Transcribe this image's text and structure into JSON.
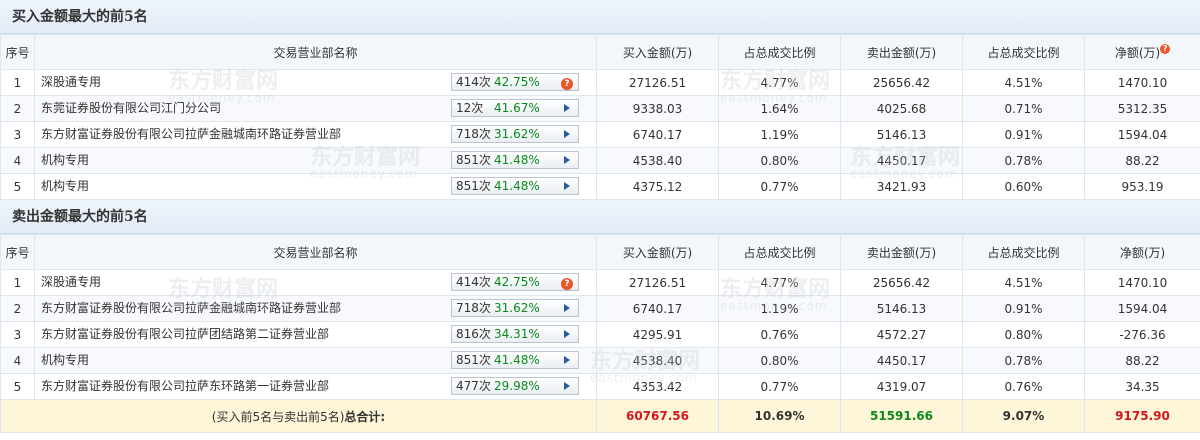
{
  "buy_section": {
    "title": "买入金额最大的前5名",
    "headers": [
      "序号",
      "交易营业部名称",
      "买入金额(万)",
      "占总成交比例",
      "卖出金额(万)",
      "占总成交比例",
      "净额(万)"
    ],
    "rows": [
      {
        "idx": "1",
        "name": "深股通专用",
        "count": "414次",
        "pct": "42.75%",
        "buy": "27126.51",
        "buy_ratio": "4.77%",
        "sell": "25656.42",
        "sell_ratio": "4.51%",
        "net": "1470.10",
        "icon": "question-icon"
      },
      {
        "idx": "2",
        "name": "东莞证券股份有限公司江门分公司",
        "count": "12次",
        "pct": "41.67%",
        "buy": "9338.03",
        "buy_ratio": "1.64%",
        "sell": "4025.68",
        "sell_ratio": "0.71%",
        "net": "5312.35",
        "icon": "play-icon"
      },
      {
        "idx": "3",
        "name": "东方财富证券股份有限公司拉萨金融城南环路证券营业部",
        "count": "718次",
        "pct": "31.62%",
        "buy": "6740.17",
        "buy_ratio": "1.19%",
        "sell": "5146.13",
        "sell_ratio": "0.91%",
        "net": "1594.04",
        "icon": "play-icon"
      },
      {
        "idx": "4",
        "name": "机构专用",
        "count": "851次",
        "pct": "41.48%",
        "buy": "4538.40",
        "buy_ratio": "0.80%",
        "sell": "4450.17",
        "sell_ratio": "0.78%",
        "net": "88.22",
        "icon": "play-icon"
      },
      {
        "idx": "5",
        "name": "机构专用",
        "count": "851次",
        "pct": "41.48%",
        "buy": "4375.12",
        "buy_ratio": "0.77%",
        "sell": "3421.93",
        "sell_ratio": "0.60%",
        "net": "953.19",
        "icon": "play-icon"
      }
    ]
  },
  "sell_section": {
    "title": "卖出金额最大的前5名",
    "headers": [
      "序号",
      "交易营业部名称",
      "买入金额(万)",
      "占总成交比例",
      "卖出金额(万)",
      "占总成交比例",
      "净额(万)"
    ],
    "rows": [
      {
        "idx": "1",
        "name": "深股通专用",
        "count": "414次",
        "pct": "42.75%",
        "buy": "27126.51",
        "buy_ratio": "4.77%",
        "sell": "25656.42",
        "sell_ratio": "4.51%",
        "net": "1470.10",
        "net_color": "red",
        "icon": "question-icon"
      },
      {
        "idx": "2",
        "name": "东方财富证券股份有限公司拉萨金融城南环路证券营业部",
        "count": "718次",
        "pct": "31.62%",
        "buy": "6740.17",
        "buy_ratio": "1.19%",
        "sell": "5146.13",
        "sell_ratio": "0.91%",
        "net": "1594.04",
        "net_color": "red",
        "icon": "play-icon"
      },
      {
        "idx": "3",
        "name": "东方财富证券股份有限公司拉萨团结路第二证券营业部",
        "count": "816次",
        "pct": "34.31%",
        "buy": "4295.91",
        "buy_ratio": "0.76%",
        "sell": "4572.27",
        "sell_ratio": "0.80%",
        "net": "-276.36",
        "net_color": "green",
        "icon": "play-icon"
      },
      {
        "idx": "4",
        "name": "机构专用",
        "count": "851次",
        "pct": "41.48%",
        "buy": "4538.40",
        "buy_ratio": "0.80%",
        "sell": "4450.17",
        "sell_ratio": "0.78%",
        "net": "88.22",
        "net_color": "red",
        "icon": "play-icon"
      },
      {
        "idx": "5",
        "name": "东方财富证券股份有限公司拉萨东环路第一证券营业部",
        "count": "477次",
        "pct": "29.98%",
        "buy": "4353.42",
        "buy_ratio": "0.77%",
        "sell": "4319.07",
        "sell_ratio": "0.76%",
        "net": "34.35",
        "net_color": "red",
        "icon": "play-icon"
      }
    ],
    "total": {
      "label_prefix": "(买入前5名与卖出前5名)",
      "label_bold": "总合计:",
      "buy": "60767.56",
      "buy_ratio": "10.69%",
      "sell": "51591.66",
      "sell_ratio": "9.07%",
      "net": "9175.90"
    }
  },
  "watermark": {
    "cn": "东方财富网",
    "en": "eastmoney.com"
  },
  "colors": {
    "buy": "#d4161d",
    "sell": "#0a8a1a",
    "total_bg": "#fdf6d8",
    "header_bg": "#e2ecf7"
  }
}
